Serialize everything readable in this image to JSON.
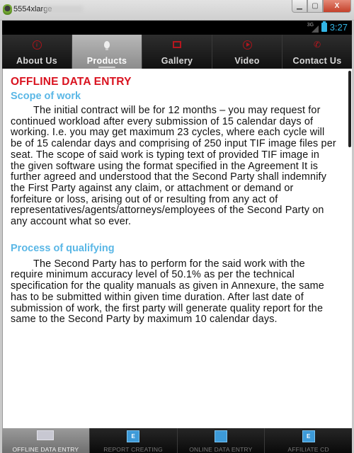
{
  "window": {
    "title": "5554xlarge",
    "minimize_icon": "minimize-icon",
    "maximize_icon": "maximize-icon",
    "close_label": "X"
  },
  "status_bar": {
    "network": "3G",
    "time": "3:27"
  },
  "top_tabs": [
    {
      "label": "About Us",
      "icon": "info-icon",
      "active": false
    },
    {
      "label": "Products",
      "icon": "lightbulb-icon",
      "active": true
    },
    {
      "label": "Gallery",
      "icon": "gallery-icon",
      "active": false
    },
    {
      "label": "Video",
      "icon": "play-icon",
      "active": false
    },
    {
      "label": "Contact Us",
      "icon": "phone-icon",
      "active": false
    }
  ],
  "content": {
    "title": "OFFLINE DATA ENTRY",
    "sections": [
      {
        "heading": "Scope of work",
        "body": "The initial contract will be for 12 months – you may request for continued workload after every submission of 15 calendar days of working. I.e. you may get maximum 23 cycles, where each cycle will be of 15 calendar days and comprising of 250 input TIF image files per seat. The scope of said work is typing text of provided TIF image in the given software using the format specified in the Agreement It is further agreed and understood that the Second Party shall indemnify the First Party against any claim, or attachment or demand or forfeiture or loss, arising out of or resulting from any act of representatives/agents/attorneys/employees of the Second Party on any account what so ever."
      },
      {
        "heading": "Process of qualifying",
        "body": "The Second Party has to perform for the said work with the require minimum accuracy level of 50.1% as per the technical specification for the quality manuals as given in Annexure, the same has to be submitted within given time duration. After last date of submission of work, the first party will generate quality report for the same to the Second Party by maximum 10 calendar days."
      }
    ]
  },
  "bottom_tabs": [
    {
      "label": "OFFLINE DATA ENTRY",
      "icon": "keyboard-icon",
      "active": true
    },
    {
      "label": "REPORT CREATING",
      "icon": "clipboard-icon",
      "active": false
    },
    {
      "label": "ONLINE DATA ENTRY",
      "icon": "laptop-icon",
      "active": false
    },
    {
      "label": "AFFILIATE CD",
      "icon": "cd-copy-icon",
      "active": false
    }
  ]
}
